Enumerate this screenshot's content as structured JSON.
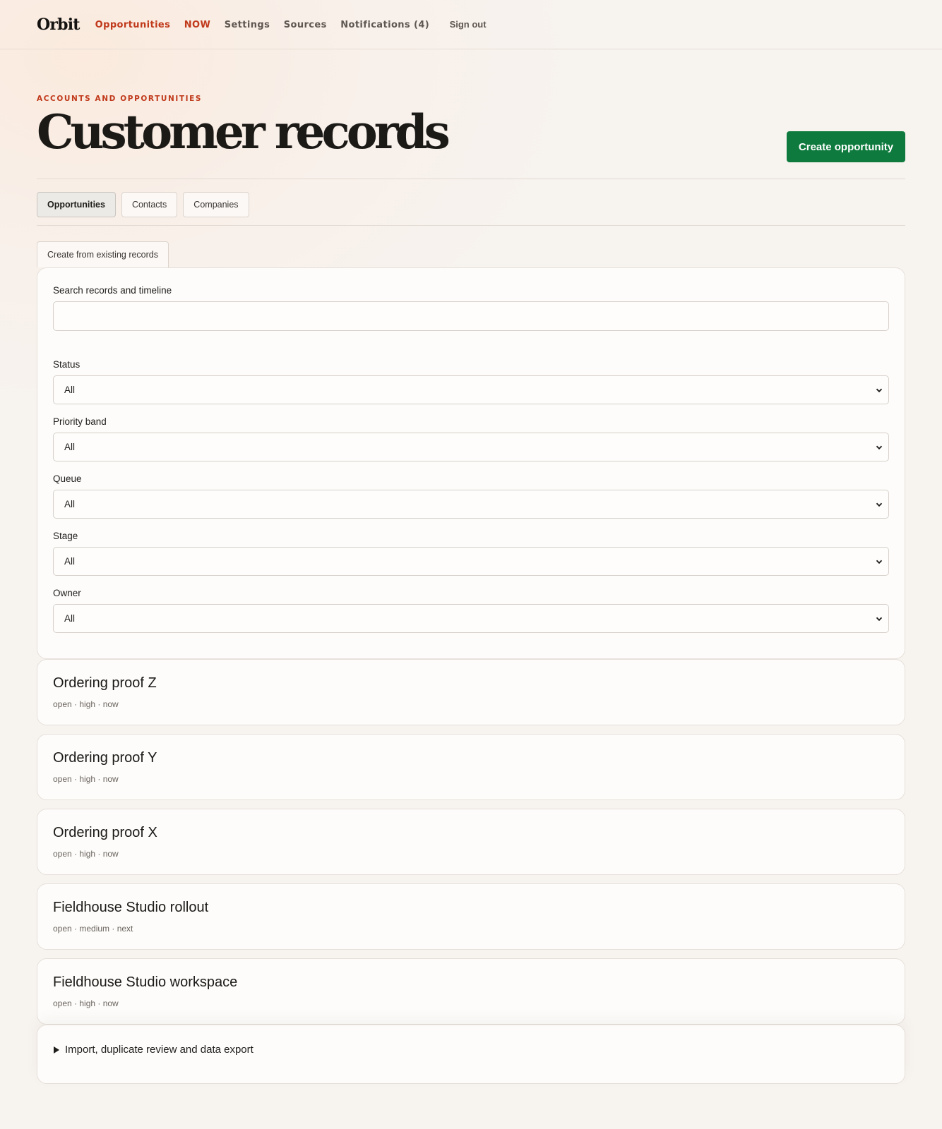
{
  "app": {
    "name": "Orbit"
  },
  "nav": {
    "opportunities": "Opportunities",
    "now": "NOW",
    "settings": "Settings",
    "sources": "Sources",
    "notifications": "Notifications (4)",
    "signout": "Sign out"
  },
  "header": {
    "eyebrow": "ACCOUNTS AND OPPORTUNITIES",
    "title": "Customer records",
    "create_button": "Create opportunity"
  },
  "tabs": [
    {
      "label": "Opportunities",
      "selected": true
    },
    {
      "label": "Contacts",
      "selected": false
    },
    {
      "label": "Companies",
      "selected": false
    }
  ],
  "existing_button": "Create from existing records",
  "filters": {
    "search_label": "Search records and timeline",
    "search_value": "",
    "status": {
      "label": "Status",
      "value": "All"
    },
    "priority": {
      "label": "Priority band",
      "value": "All"
    },
    "queue": {
      "label": "Queue",
      "value": "All"
    },
    "stage": {
      "label": "Stage",
      "value": "All"
    },
    "owner": {
      "label": "Owner",
      "value": "All"
    }
  },
  "records": [
    {
      "title": "Ordering proof Z",
      "meta": "open · high · now"
    },
    {
      "title": "Ordering proof Y",
      "meta": "open · high · now"
    },
    {
      "title": "Ordering proof X",
      "meta": "open · high · now"
    },
    {
      "title": "Fieldhouse Studio rollout",
      "meta": "open · medium · next"
    },
    {
      "title": "Fieldhouse Studio workspace",
      "meta": "open · high · now"
    }
  ],
  "details_summary": "Import, duplicate review and data export",
  "colors": {
    "accent": "#c0391b",
    "primary_button": "#0e7a3d",
    "background": "#f7f3ef"
  }
}
